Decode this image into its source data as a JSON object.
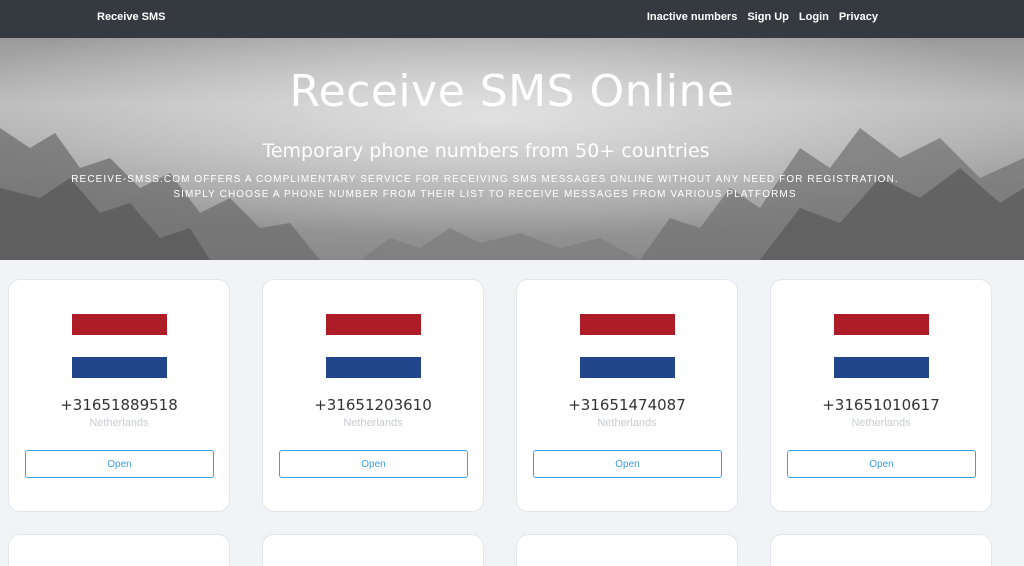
{
  "nav": {
    "brand": "Receive SMS",
    "links": [
      "Inactive numbers",
      "Sign Up",
      "Login",
      "Privacy"
    ]
  },
  "hero": {
    "title": "Receive SMS Online",
    "subtitle": "Temporary phone numbers from 50+ countries",
    "description_line1": "Receive-smss.com offers a complimentary service for receiving SMS messages online without any need for registration.",
    "description_line2": "Simply choose a phone number from their list to receive messages from various platforms"
  },
  "colors": {
    "nav_bg": "#343a40",
    "flag_red": "#ae1c28",
    "flag_blue": "#21468b",
    "button_accent": "#3a9fe0"
  },
  "cards": [
    {
      "number": "+31651889518",
      "country": "Netherlands",
      "button": "Open",
      "flag": "netherlands-flag"
    },
    {
      "number": "+31651203610",
      "country": "Netherlands",
      "button": "Open",
      "flag": "netherlands-flag"
    },
    {
      "number": "+31651474087",
      "country": "Netherlands",
      "button": "Open",
      "flag": "netherlands-flag"
    },
    {
      "number": "+31651010617",
      "country": "Netherlands",
      "button": "Open",
      "flag": "netherlands-flag"
    }
  ]
}
